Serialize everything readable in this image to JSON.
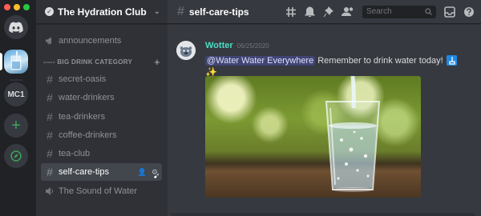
{
  "window": {
    "controls": [
      "close",
      "minimize",
      "zoom"
    ]
  },
  "servers": [
    {
      "icon": "discord-home-icon"
    },
    {
      "icon": "water-server-icon",
      "active": true
    },
    {
      "label": "MC1"
    },
    {
      "icon": "add-server-icon"
    },
    {
      "icon": "compass-icon"
    }
  ],
  "guild": {
    "name": "The Hydration Club"
  },
  "channels": {
    "announcements": "announcements",
    "category": "----- BIG DRINK CATEGORY",
    "items": [
      "secret-oasis",
      "water-drinkers",
      "tea-drinkers",
      "coffee-drinkers",
      "tea-club",
      "self-care-tips"
    ],
    "voice": "The Sound of Water"
  },
  "header": {
    "channel": "self-care-tips",
    "search_placeholder": "Search"
  },
  "message": {
    "author": "Wotter",
    "timestamp": "06/25/2020",
    "mention": "@Water Water Everywhere",
    "text": "Remember to drink water today!",
    "sparkles": "✨"
  },
  "colors": {
    "author": "#4fdcc8",
    "active_channel_bg": "#42464d",
    "add_server": "#3ba55d"
  }
}
